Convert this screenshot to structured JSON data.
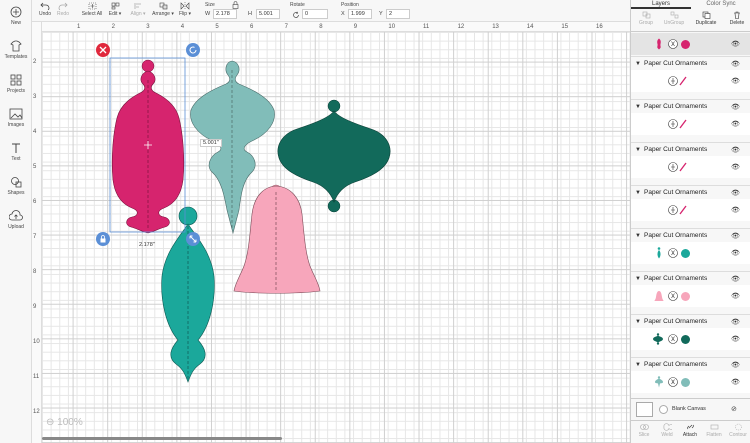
{
  "sidebar": {
    "items": [
      {
        "label": "New",
        "icon": "plus-icon"
      },
      {
        "label": "Templates",
        "icon": "shirt-icon"
      },
      {
        "label": "Projects",
        "icon": "grid-icon"
      },
      {
        "label": "Images",
        "icon": "image-icon"
      },
      {
        "label": "Text",
        "icon": "text-icon"
      },
      {
        "label": "Shapes",
        "icon": "shapes-icon"
      },
      {
        "label": "Upload",
        "icon": "upload-icon"
      }
    ]
  },
  "toolbar": {
    "undo": "Undo",
    "redo": "Redo",
    "select_all": "Select All",
    "edit": "Edit",
    "align": "Align",
    "arrange": "Arrange",
    "flip": "Flip",
    "size_label": "Size",
    "w_label": "W",
    "w_value": "2.178",
    "h_label": "H",
    "h_value": "5.001",
    "rotate_label": "Rotate",
    "rotate_value": "0",
    "position_label": "Position",
    "x_label": "X",
    "x_value": "1.999",
    "y_label": "Y",
    "y_value": "2"
  },
  "canvas": {
    "ruler_top": [
      "1",
      "2",
      "3",
      "4",
      "5",
      "6",
      "7",
      "8",
      "9",
      "10",
      "11",
      "12",
      "13",
      "14",
      "15",
      "16"
    ],
    "ruler_left": [
      "2",
      "3",
      "4",
      "5",
      "6",
      "7",
      "8",
      "9",
      "10",
      "11",
      "12"
    ],
    "height_readout": "5.001\"",
    "width_readout": "2.178\"",
    "zoom": "100%",
    "colors": {
      "magenta": "#d6246e",
      "sage": "#81bdb9",
      "dark_green": "#126a5b",
      "pink": "#f7a6bb",
      "teal": "#1ba89b",
      "selection": "#5b8fd6"
    }
  },
  "panel": {
    "tabs": [
      "Layers",
      "Color Sync"
    ],
    "actions": [
      "Group",
      "UnGroup",
      "Duplicate",
      "Delete"
    ],
    "group_name": "Paper Cut Ornaments",
    "groups": [
      {
        "name": "Paper Cut Ornaments",
        "detail": "cut"
      },
      {
        "name": "Paper Cut Ornaments",
        "detail": "cut"
      },
      {
        "name": "Paper Cut Ornaments",
        "detail": "cut"
      },
      {
        "name": "Paper Cut Ornaments",
        "detail": "cut"
      },
      {
        "name": "Paper Cut Ornaments",
        "detail": "teal"
      },
      {
        "name": "Paper Cut Ornaments",
        "detail": "pink"
      },
      {
        "name": "Paper Cut Ornaments",
        "detail": "darkgreen"
      },
      {
        "name": "Paper Cut Ornaments",
        "detail": "sage"
      }
    ],
    "blank_canvas": "Blank Canvas",
    "bottom_actions": [
      "Slice",
      "Weld",
      "Attach",
      "Flatten",
      "Contour"
    ]
  }
}
